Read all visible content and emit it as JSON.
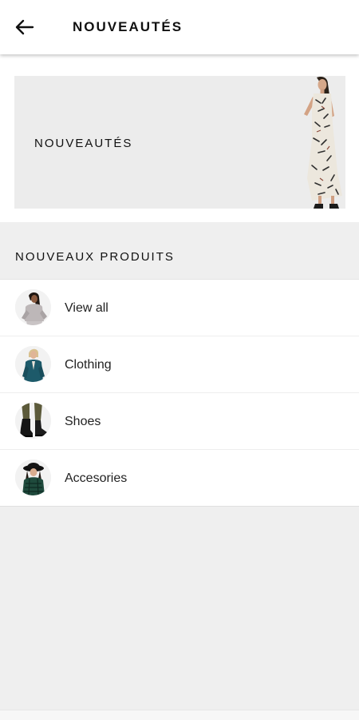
{
  "header": {
    "back_icon": "arrow-left-icon",
    "title": "NOUVEAUTÉS"
  },
  "banner": {
    "title": "NOUVEAUTÉS",
    "image": "model-in-printed-dress"
  },
  "section": {
    "title": "NOUVEAUX PRODUITS"
  },
  "categories": [
    {
      "label": "View all",
      "image": "model-grey-knit-sweater"
    },
    {
      "label": "Clothing",
      "image": "model-teal-blazer"
    },
    {
      "label": "Shoes",
      "image": "black-ankle-boots"
    },
    {
      "label": "Accesories",
      "image": "model-black-hat-green-coat"
    }
  ],
  "colors": {
    "background": "#efefef",
    "surface": "#ffffff",
    "banner_bg": "#ececec",
    "text": "#111111"
  }
}
